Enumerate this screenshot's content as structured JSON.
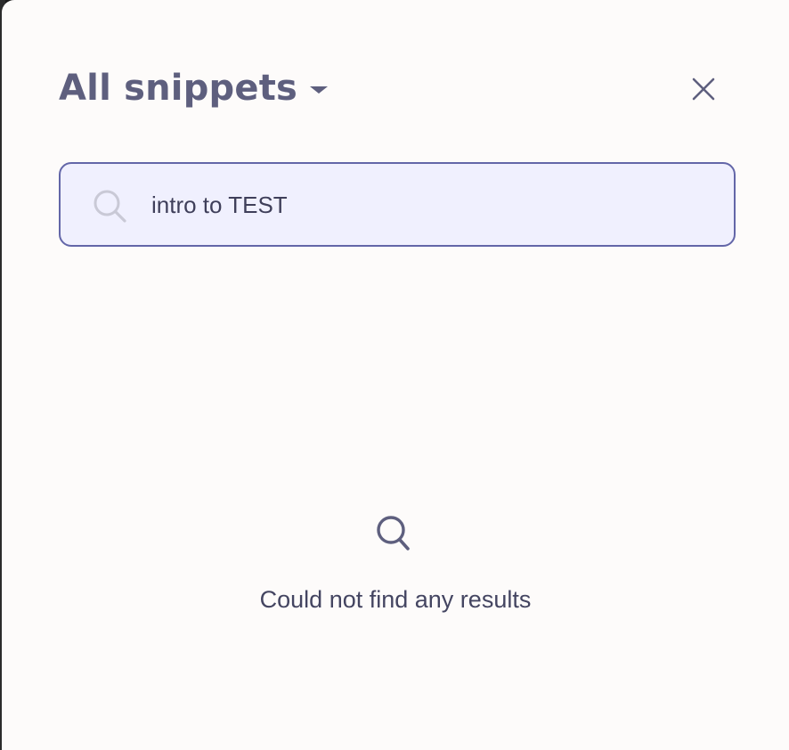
{
  "modal": {
    "title": "All snippets",
    "title_dropdown_icon": "caret-down-icon",
    "close_icon": "close-icon"
  },
  "search": {
    "icon": "search-icon",
    "value": "intro to TEST"
  },
  "empty_state": {
    "icon": "search-icon",
    "message": "Could not find any results"
  },
  "colors": {
    "panel_background": "#fdfbfa",
    "title": "#5e5f7e",
    "search_background": "#f0f0fe",
    "search_border": "#6366a8",
    "text": "#444561"
  }
}
